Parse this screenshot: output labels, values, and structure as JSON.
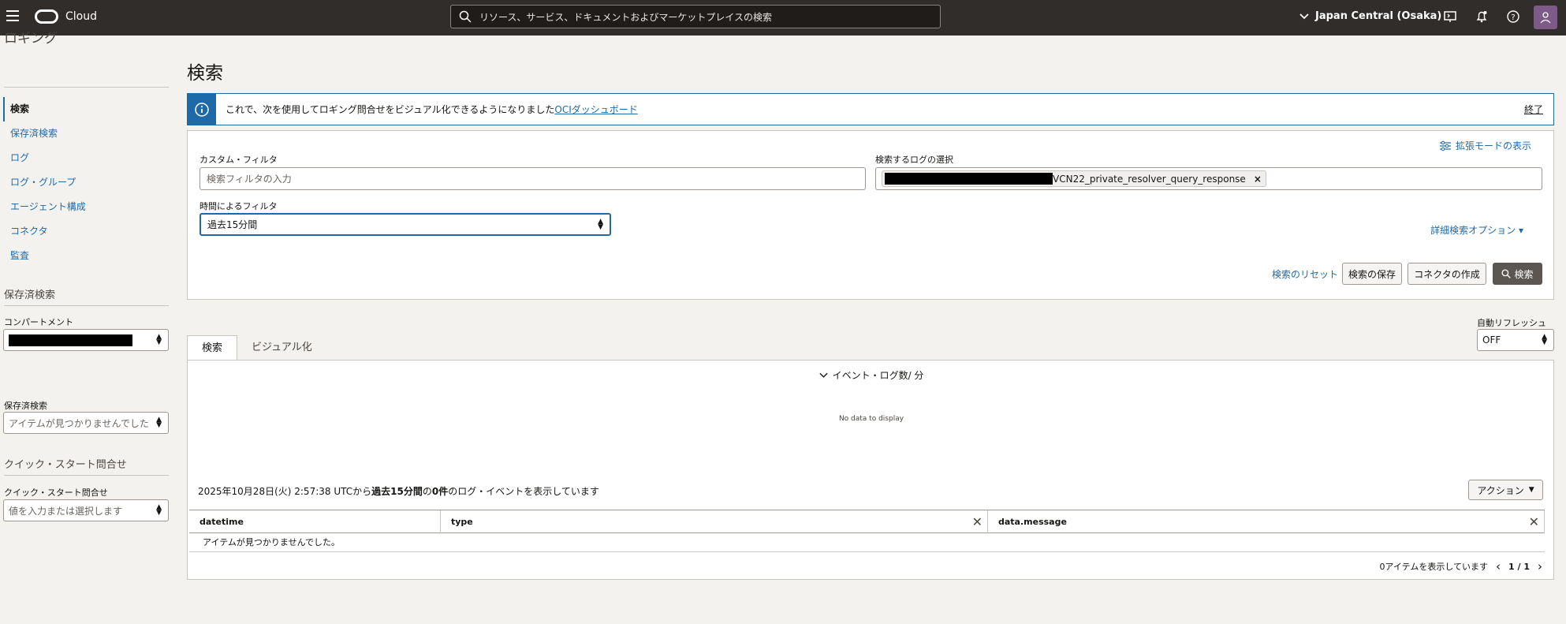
{
  "topbar": {
    "brand": "Cloud",
    "search_placeholder": "リソース、サービス、ドキュメントおよびマーケットプレイスの検索",
    "region": "Japan Central (Osaka)"
  },
  "sidebar": {
    "title": "ロギング",
    "items": [
      {
        "label": "検索",
        "active": true
      },
      {
        "label": "保存済検索"
      },
      {
        "label": "ログ"
      },
      {
        "label": "ログ・グループ"
      },
      {
        "label": "エージェント構成"
      },
      {
        "label": "コネクタ"
      },
      {
        "label": "監査"
      }
    ],
    "saved_section_title": "保存済検索",
    "compartment_label": "コンパートメント",
    "saved_search_label": "保存済検索",
    "saved_search_placeholder": "アイテムが見つかりませんでした",
    "quickstart_section_title": "クイック・スタート問合せ",
    "quickstart_label": "クイック・スタート問合せ",
    "quickstart_placeholder": "値を入力または選択します"
  },
  "main": {
    "title": "検索",
    "banner": {
      "text": "これで、次を使用してロギング問合せをビジュアル化できるようになりました",
      "link": "OCIダッシュボード",
      "close": "終了"
    },
    "filters": {
      "advanced_mode": "拡張モードの表示",
      "custom_filter_label": "カスタム・フィルタ",
      "custom_filter_placeholder": "検索フィルタの入力",
      "log_select_label": "検索するログの選択",
      "log_chip": "VCN22_private_resolver_query_response",
      "time_filter_label": "時間によるフィルタ",
      "time_filter_value": "過去15分間",
      "advanced_options": "詳細検索オプション ▾",
      "reset": "検索のリセット",
      "save": "検索の保存",
      "create_connector": "コネクタの作成",
      "search": "検索"
    },
    "tabs": [
      "検索",
      "ビジュアル化"
    ],
    "auto_refresh_label": "自動リフレッシュ",
    "auto_refresh_value": "OFF",
    "histogram_title": "イベント・ログ数/ 分",
    "no_data": "No data to display",
    "summary_prefix": "2025年10月28日(火) 2:57:38 UTCから",
    "summary_range": "過去15分間",
    "summary_mid": "の",
    "summary_count": "0件",
    "summary_suffix": "のログ・イベントを表示しています",
    "actions": "アクション",
    "columns": [
      "datetime",
      "type",
      "data.message"
    ],
    "empty_message": "アイテムが見つかりませんでした。",
    "footer_count": "0アイテムを表示しています",
    "pagination": "1 / 1"
  }
}
